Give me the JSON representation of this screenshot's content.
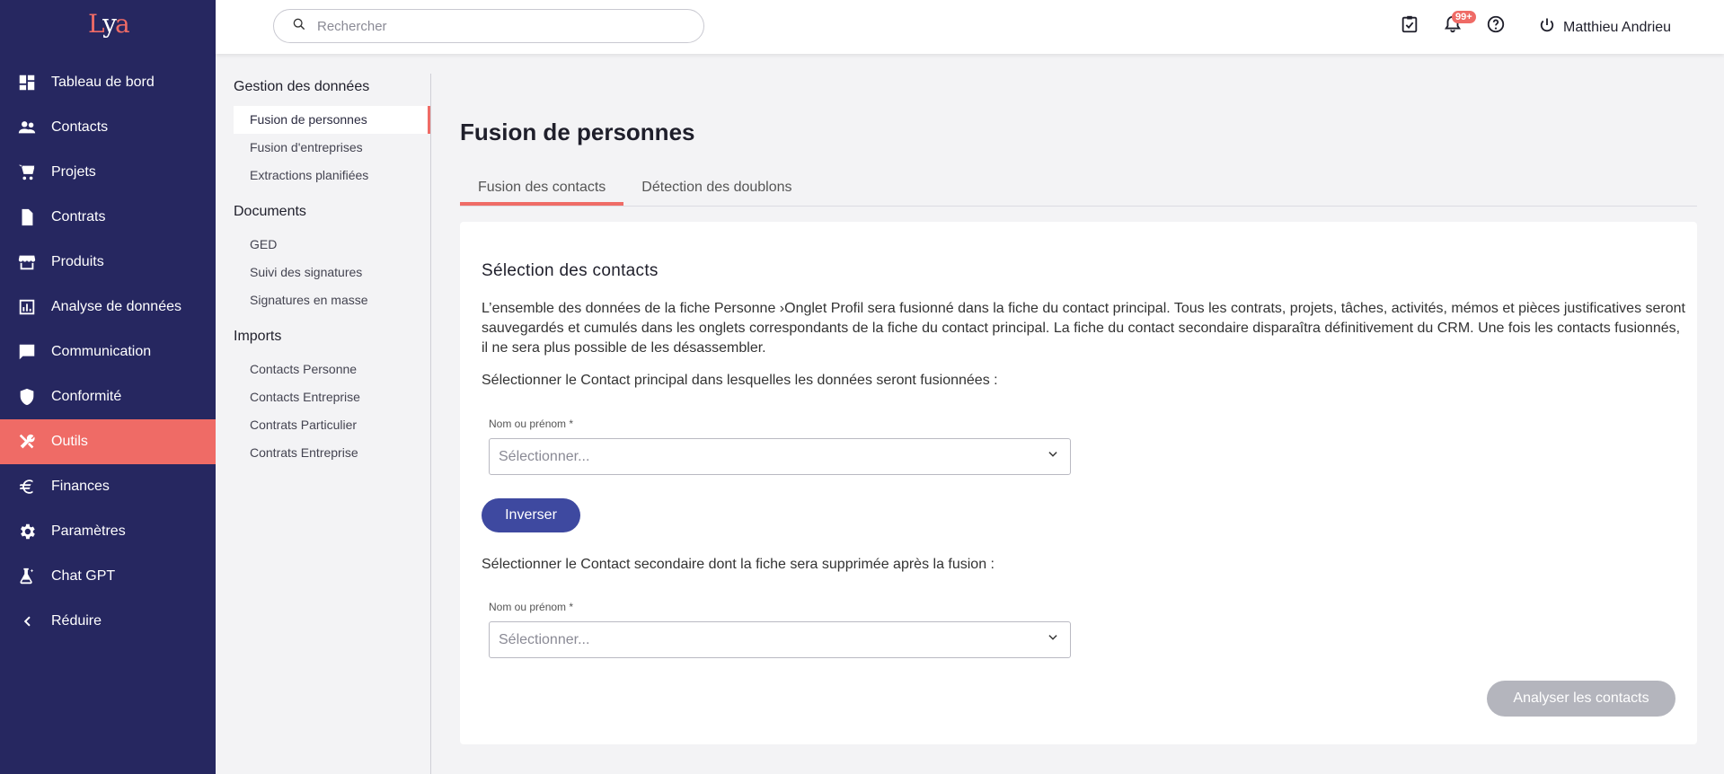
{
  "brand": {
    "logo_left": "L",
    "logo_mid": "y",
    "logo_right": "a",
    "accent": "#ef6b66",
    "sidebar_bg": "#262760",
    "primary": "#3e49a0"
  },
  "sidebar": {
    "items": [
      {
        "label": "Tableau de bord",
        "icon": "dashboard-icon"
      },
      {
        "label": "Contacts",
        "icon": "people-icon"
      },
      {
        "label": "Projets",
        "icon": "cart-icon"
      },
      {
        "label": "Contrats",
        "icon": "document-icon"
      },
      {
        "label": "Produits",
        "icon": "store-icon"
      },
      {
        "label": "Analyse de données",
        "icon": "chart-icon"
      },
      {
        "label": "Communication",
        "icon": "chat-icon"
      },
      {
        "label": "Conformité",
        "icon": "shield-check-icon"
      },
      {
        "label": "Outils",
        "icon": "tools-icon",
        "active": true
      },
      {
        "label": "Finances",
        "icon": "euro-icon"
      },
      {
        "label": "Paramètres",
        "icon": "gear-icon"
      },
      {
        "label": "Chat GPT",
        "icon": "flask-icon"
      },
      {
        "label": "Réduire",
        "icon": "chevron-left-icon"
      }
    ]
  },
  "header": {
    "search_placeholder": "Rechercher",
    "notification_count": "99+",
    "user_name": "Matthieu Andrieu"
  },
  "subnav": {
    "groups": [
      {
        "title": "Gestion des données",
        "links": [
          "Fusion de personnes",
          "Fusion d'entreprises",
          "Extractions planifiées"
        ]
      },
      {
        "title": "Documents",
        "links": [
          "GED",
          "Suivi des signatures",
          "Signatures en masse"
        ]
      },
      {
        "title": "Imports",
        "links": [
          "Contacts Personne",
          "Contacts Entreprise",
          "Contrats Particulier",
          "Contrats Entreprise"
        ]
      }
    ]
  },
  "main": {
    "title": "Fusion de personnes",
    "tabs": [
      "Fusion des contacts",
      "Détection des doublons"
    ],
    "card": {
      "heading": "Sélection des contacts",
      "description": "L’ensemble des données de la fiche Personne ›Onglet Profil sera fusionné dans la fiche du contact principal. Tous les contrats, projets, tâches, activités, mémos et pièces justificatives seront sauvegardés et cumulés dans les onglets correspondants de la fiche du contact principal. La fiche du contact secondaire disparaîtra définitivement du CRM. Une fois les contacts fusionnés, il ne sera plus possible de les désassembler.",
      "instruction_primary": "Sélectionner le Contact principal dans lesquelles les données seront fusionnées :",
      "field_label": "Nom ou prénom *",
      "select_placeholder": "Sélectionner...",
      "swap_button": "Inverser",
      "instruction_secondary": "Sélectionner le Contact secondaire dont la fiche sera supprimée après la fusion :",
      "analyse_button": "Analyser les contacts"
    }
  }
}
